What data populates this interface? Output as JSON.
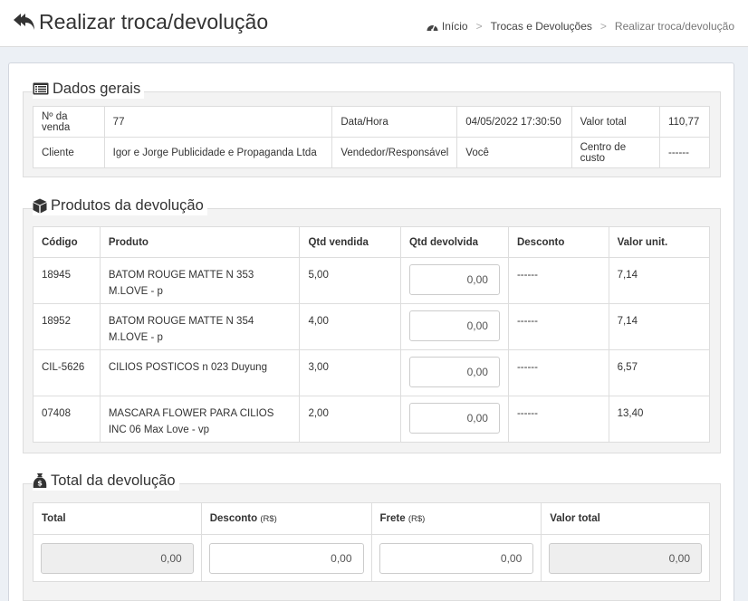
{
  "header": {
    "title": "Realizar troca/devolução",
    "breadcrumb": [
      "Início",
      "Trocas e Devoluções",
      "Realizar troca/devolução"
    ]
  },
  "dados_gerais": {
    "legend": "Dados gerais",
    "labels": {
      "venda": "Nº da venda",
      "data": "Data/Hora",
      "valor_total": "Valor total",
      "cliente": "Cliente",
      "vendedor": "Vendedor/Responsável",
      "centro": "Centro de custo"
    },
    "values": {
      "venda": "77",
      "data": "04/05/2022 17:30:50",
      "valor_total": "110,77",
      "cliente": "Igor e Jorge Publicidade e Propaganda Ltda",
      "vendedor": "Você",
      "centro": "------"
    }
  },
  "produtos": {
    "legend": "Produtos da devolução",
    "columns": [
      "Código",
      "Produto",
      "Qtd vendida",
      "Qtd devolvida",
      "Desconto",
      "Valor unit."
    ],
    "rows": [
      {
        "codigo": "18945",
        "produto": "BATOM ROUGE MATTE N 353 M.LOVE - p",
        "qtd_vendida": "5,00",
        "qtd_devolvida": "0,00",
        "desconto": "------",
        "valor_unit": "7,14"
      },
      {
        "codigo": "18952",
        "produto": "BATOM ROUGE MATTE N 354 M.LOVE - p",
        "qtd_vendida": "4,00",
        "qtd_devolvida": "0,00",
        "desconto": "------",
        "valor_unit": "7,14"
      },
      {
        "codigo": "CIL-5626",
        "produto": "CILIOS POSTICOS n 023 Duyung",
        "qtd_vendida": "3,00",
        "qtd_devolvida": "0,00",
        "desconto": "------",
        "valor_unit": "6,57"
      },
      {
        "codigo": "07408",
        "produto": "MASCARA FLOWER PARA CILIOS INC 06 Max Love - vp",
        "qtd_vendida": "2,00",
        "qtd_devolvida": "0,00",
        "desconto": "------",
        "valor_unit": "13,40"
      }
    ]
  },
  "total": {
    "legend": "Total da devolução",
    "columns": {
      "total": "Total",
      "desconto": "Desconto",
      "desconto_unit": "(R$)",
      "frete": "Frete",
      "frete_unit": "(R$)",
      "valor_total": "Valor total"
    },
    "values": {
      "total": "0,00",
      "desconto": "0,00",
      "frete": "0,00",
      "valor_total": "0,00"
    }
  },
  "icons": {
    "back": "reply-all-icon",
    "breadcrumb_home": "dashboard-icon",
    "dados_gerais": "list-alt-icon",
    "produtos": "cube-icon",
    "total": "money-bag-icon"
  }
}
